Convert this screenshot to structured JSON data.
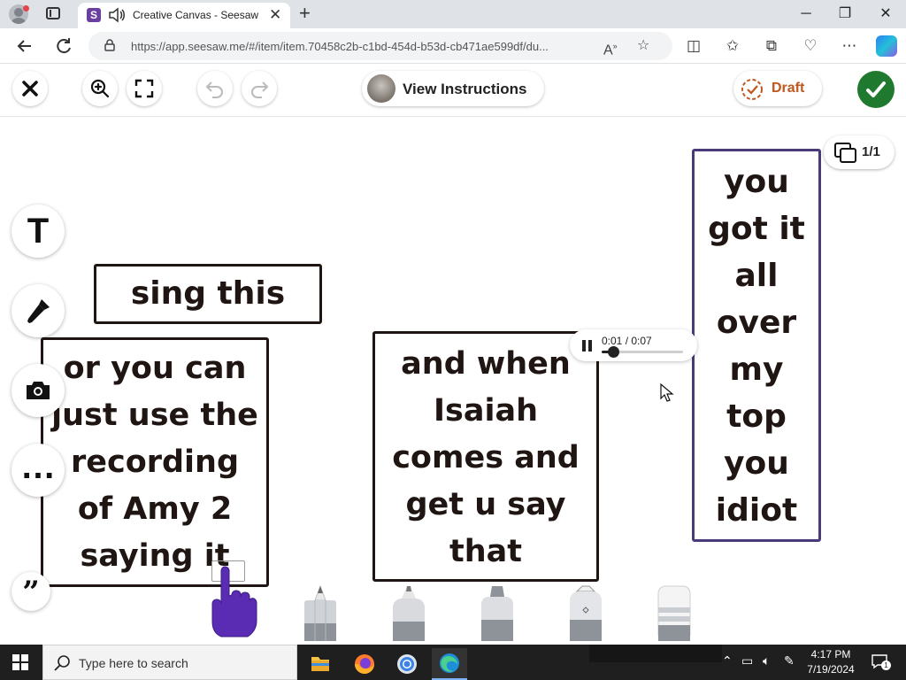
{
  "browser": {
    "tab_title": "Creative Canvas - Seesaw",
    "tab_favicon_letter": "S",
    "url": "https://app.seesaw.me/#/item/item.70458c2b-c1bd-454d-b53d-cb471ae599df/du...",
    "icons": {
      "profile": "profile-icon",
      "tabs": "tab-actions-icon",
      "speaker": "speaker-icon",
      "close_tab": "close-icon",
      "new_tab": "plus-icon",
      "back": "back-arrow-icon",
      "refresh": "refresh-icon",
      "lock": "lock-icon",
      "read_aloud": "read-aloud-icon",
      "favorite": "star-icon",
      "split": "split-screen-icon",
      "favorites": "favorites-icon",
      "collections": "collections-icon",
      "performance": "heartbeat-icon",
      "more": "more-icon",
      "copilot": "copilot-icon"
    }
  },
  "app": {
    "toolbar": {
      "close_icon": "close-icon",
      "zoom_icon": "zoom-in-icon",
      "fullscreen_icon": "fullscreen-icon",
      "undo_icon": "undo-icon",
      "redo_icon": "redo-icon",
      "view_instructions_label": "View Instructions",
      "draft_label": "Draft",
      "done_icon": "checkmark-icon"
    },
    "page_indicator": "1/1",
    "side_tools": [
      "text-tool",
      "microphone-tool",
      "camera-tool",
      "more-tool",
      "quote-tool"
    ],
    "side_text_glyph": "T",
    "side_more_glyph": "…",
    "side_quote_glyph": "”",
    "textboxes": {
      "tb1": [
        "sing this"
      ],
      "tb2": [
        "or you can",
        "just use the",
        "recording",
        "of Amy 2",
        "saying it"
      ],
      "tb3": [
        "and when",
        "Isaiah",
        "comes and",
        "get u say",
        "that"
      ],
      "tb4": [
        "you",
        "got it",
        "all",
        "over",
        "my",
        "top",
        "you",
        "idiot"
      ]
    },
    "audio": {
      "time": "0:01 / 0:07",
      "progress": 0.14
    },
    "pen_tools": [
      "pencil",
      "crayon",
      "marker",
      "glitter-pen",
      "eraser"
    ]
  },
  "taskbar": {
    "search_placeholder": "Type here to search",
    "apps": [
      "file-explorer-icon",
      "firefox-icon",
      "chrome-icon",
      "edge-icon"
    ],
    "time": "4:17 PM",
    "date": "7/19/2024",
    "notification_count": "1",
    "colors": {
      "bg": "#1f1f1f",
      "accent": "#7eb4f5"
    }
  },
  "colors": {
    "seesaw_purple": "#6b3fa0",
    "done_green": "#1f7a2f",
    "draft_orange": "#c0571e",
    "text_dark": "#1f1512",
    "box4_border": "#4a3a78"
  }
}
